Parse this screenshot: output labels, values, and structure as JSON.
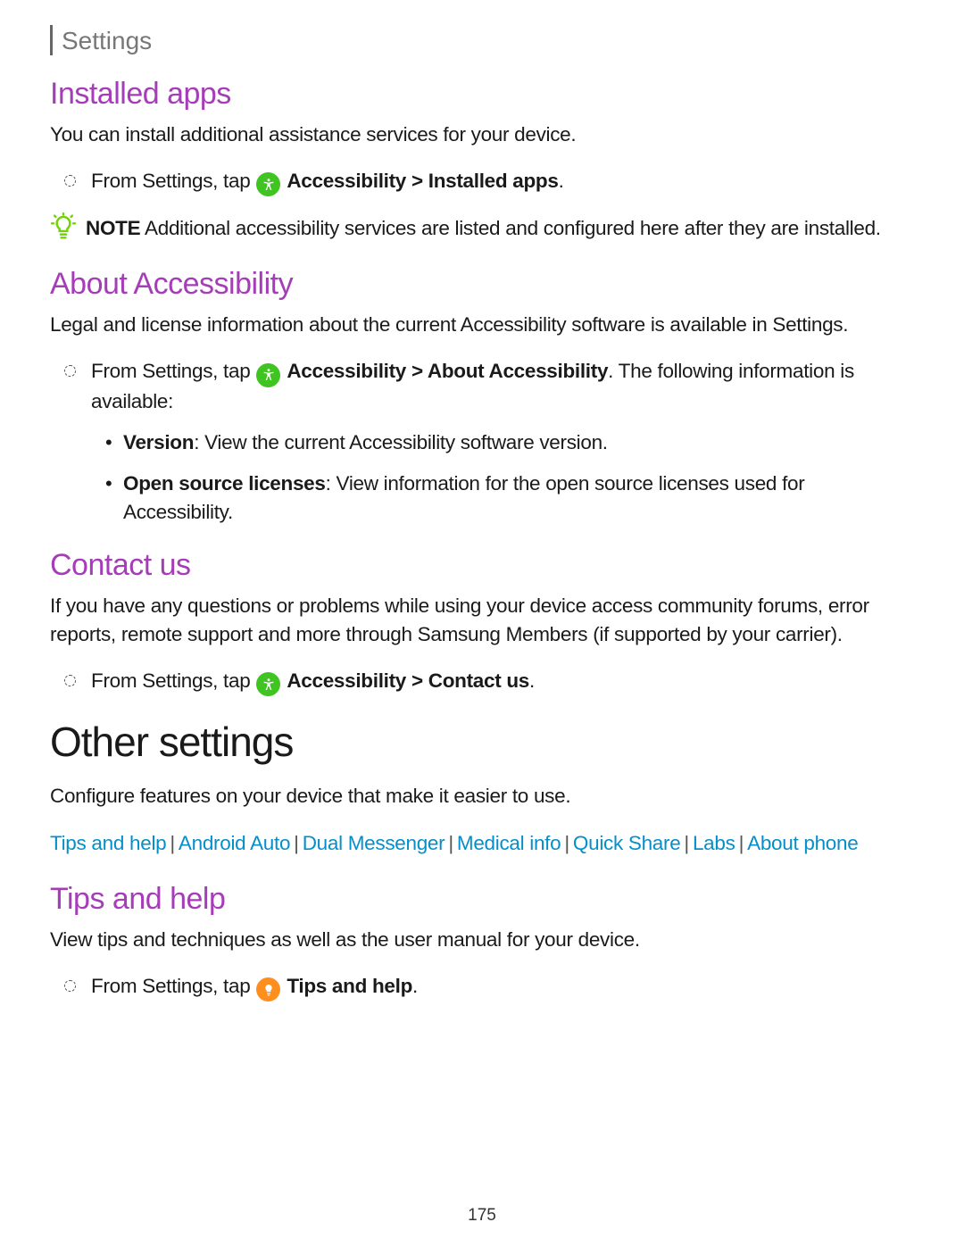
{
  "header": "Settings",
  "page_number": "175",
  "installed_apps": {
    "title": "Installed apps",
    "desc": "You can install additional assistance services for your device.",
    "step_prefix": "From Settings, tap ",
    "step_bold": "Accessibility > Installed apps",
    "step_suffix": ".",
    "note_label": "NOTE",
    "note_text": " Additional accessibility services are listed and configured here after they are installed."
  },
  "about": {
    "title": "About Accessibility",
    "desc": "Legal and license information about the current Accessibility software is available in Settings.",
    "step_prefix": "From Settings, tap ",
    "step_bold": "Accessibility > About Accessibility",
    "step_suffix": ". The following information is available:",
    "sub1_bold": "Version",
    "sub1_rest": ": View the current Accessibility software version.",
    "sub2_bold": "Open source licenses",
    "sub2_rest": ": View information for the open source licenses used for Accessibility."
  },
  "contact": {
    "title": "Contact us",
    "desc": "If you have any questions or problems while using your device access community forums, error reports, remote support and more through Samsung Members (if supported by your carrier).",
    "step_prefix": "From Settings, tap ",
    "step_bold": "Accessibility > Contact us",
    "step_suffix": "."
  },
  "other": {
    "title": "Other settings",
    "desc": "Configure features on your device that make it easier to use.",
    "links": [
      "Tips and help",
      "Android Auto",
      "Dual Messenger",
      "Medical info",
      "Quick Share",
      "Labs",
      "About phone"
    ]
  },
  "tips": {
    "title": "Tips and help",
    "desc": "View tips and techniques as well as the user manual for your device.",
    "step_prefix": "From Settings, tap ",
    "step_bold": "Tips and help",
    "step_suffix": "."
  }
}
